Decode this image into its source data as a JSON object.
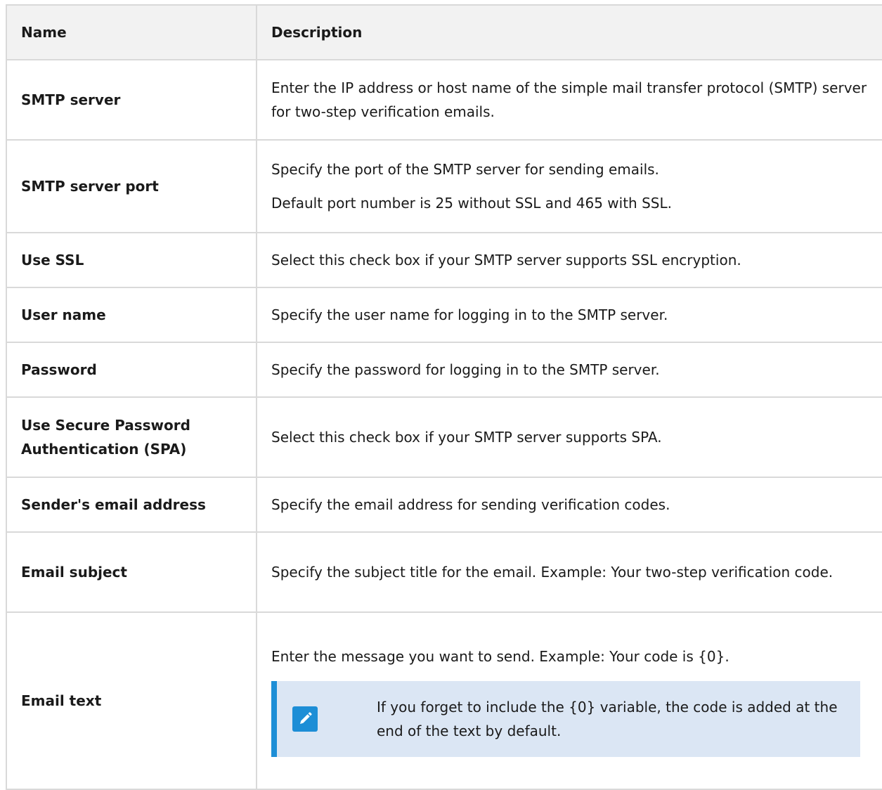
{
  "table": {
    "headers": {
      "name": "Name",
      "description": "Description"
    },
    "rows": [
      {
        "name": "SMTP server",
        "desc": [
          "Enter the IP address or host name of the simple mail transfer protocol (SMTP) server for two-step verification emails."
        ]
      },
      {
        "name": "SMTP server port",
        "desc": [
          "Specify the port of the SMTP server for sending emails.",
          "Default port number is 25 without SSL and 465 with SSL."
        ]
      },
      {
        "name": "Use SSL",
        "desc": [
          "Select this check box if your SMTP server supports SSL encryption."
        ]
      },
      {
        "name": "User name",
        "desc": [
          "Specify the user name for logging in to the SMTP server."
        ]
      },
      {
        "name": "Password",
        "desc": [
          "Specify the password for logging in to the SMTP server."
        ]
      },
      {
        "name": "Use Secure Password Authentication (SPA)",
        "desc": [
          "Select this check box if your SMTP server supports SPA."
        ]
      },
      {
        "name": "Sender's email address",
        "desc": [
          "Specify the email address for sending verification codes."
        ]
      },
      {
        "name": "Email subject",
        "desc": [
          "Specify the subject title for the email. Example: Your two-step verification code."
        ]
      },
      {
        "name": "Email text",
        "desc": [
          "Enter the message you want to send. Example: Your code is {0}."
        ],
        "note": "If you forget to include the {0} variable, the code is added at the end of the text by default."
      }
    ]
  },
  "colors": {
    "border": "#d9d9d9",
    "header_bg": "#f2f2f2",
    "note_bg": "#dbe6f4",
    "note_accent": "#1d8ed6"
  },
  "icons": {
    "note": "pencil-icon"
  }
}
